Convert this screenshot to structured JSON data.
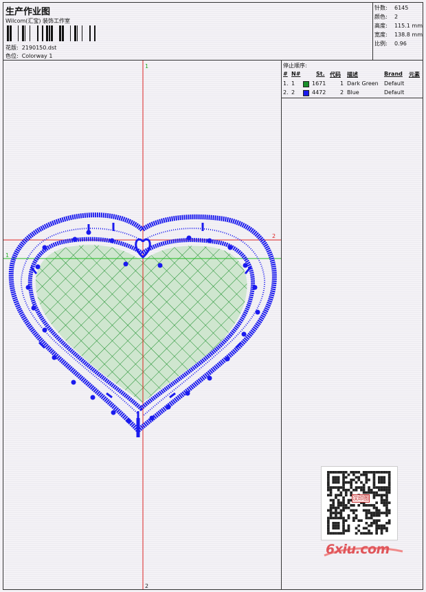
{
  "header": {
    "title": "生产作业图",
    "company": "Wilcom(汇宝) 装饰工作室",
    "design_label": "花版:",
    "design_file": "2190150.dst",
    "color_label": "色位:",
    "colorway": "Colorway 1"
  },
  "stats": [
    {
      "label": "针数:",
      "value": "6145"
    },
    {
      "label": "颜色:",
      "value": "2"
    },
    {
      "label": "高度:",
      "value": "115.1 mm"
    },
    {
      "label": "宽度:",
      "value": "138.8 mm"
    },
    {
      "label": "比例:",
      "value": "0.96"
    }
  ],
  "axis_labels": {
    "top": "1",
    "bottom": "2",
    "right": "2",
    "left": "1"
  },
  "stop_sequence": {
    "title": "停止顺序:",
    "columns": [
      "#",
      "N#",
      "St.",
      "代码",
      "描述",
      "Brand",
      "元素"
    ],
    "rows": [
      {
        "num": "1.",
        "n": "1",
        "stitches": "1671",
        "code": "1",
        "desc": "Dark Green",
        "brand": "Default",
        "color": "#1a8f2a"
      },
      {
        "num": "2.",
        "n": "2",
        "stitches": "4472",
        "code": "2",
        "desc": "Blue",
        "brand": "Default",
        "color": "#1a1aee"
      }
    ]
  },
  "colors": {
    "embroidery_blue": "#1a1aee",
    "embroidery_green": "#1a8f2a",
    "guide_red": "#dd2222",
    "guide_green": "#22bb22"
  },
  "watermark": {
    "text": "6xiu.com",
    "qr_text": "汉印图"
  }
}
